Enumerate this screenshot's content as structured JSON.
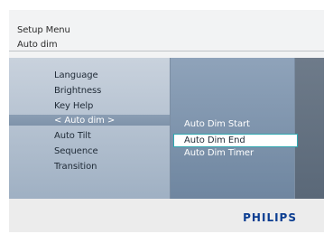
{
  "header": {
    "title": "Setup Menu",
    "subtitle": "Auto dim"
  },
  "menu": {
    "items": [
      {
        "label": "Language"
      },
      {
        "label": "Brightness"
      },
      {
        "label": "Key Help"
      },
      {
        "label": "< Auto dim >"
      },
      {
        "label": "Auto Tilt"
      },
      {
        "label": "Sequence"
      },
      {
        "label": "Transition"
      }
    ],
    "selected_label": "< Auto dim >"
  },
  "submenu": {
    "items": [
      {
        "label": "Auto Dim Start"
      },
      {
        "label": "Auto Dim End"
      },
      {
        "label": "Auto Dim Timer"
      }
    ],
    "highlighted": "Auto Dim End"
  },
  "brand": {
    "logo_text": "PHILIPS",
    "color": "#0b3d91"
  },
  "colors": {
    "highlight_border": "#2fa7b0"
  }
}
